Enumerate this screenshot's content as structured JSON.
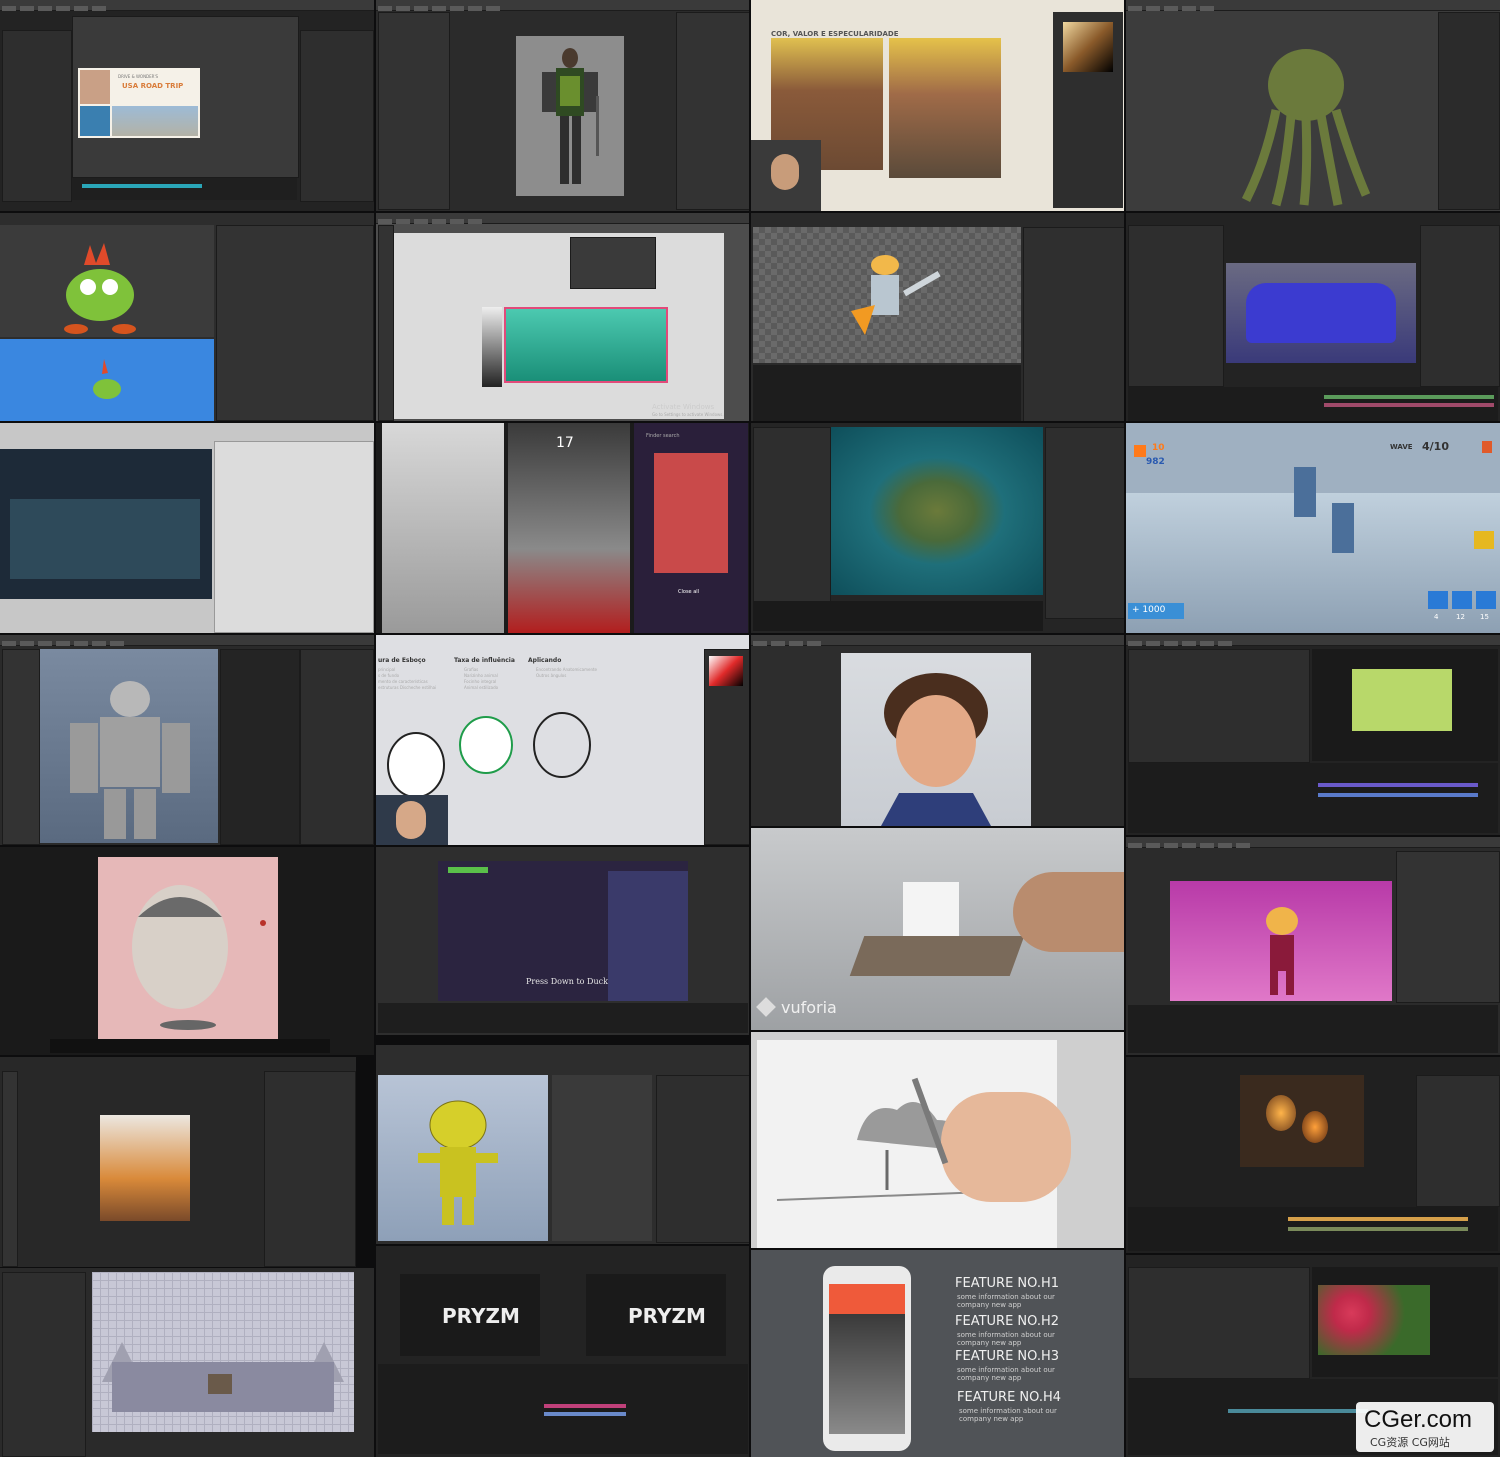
{
  "tiles": {
    "t1": {
      "overlay_title": "USA ROAD TRIP",
      "overlay_header": "DRIVE & WONDER'S"
    },
    "t2": {},
    "t3": {
      "heading": "COR, VALOR E ESPECULARIDADE"
    },
    "t4": {},
    "t5": {},
    "t6": {
      "watermark_line1": "Activate Windows",
      "watermark_line2": "Go to Settings to activate Windows."
    },
    "t7": {},
    "t8": {},
    "t9": {},
    "t10": {
      "clock": "17",
      "search_placeholder": "Finder search",
      "close_all": "Close all"
    },
    "t11": {},
    "t12": {
      "coins": "10",
      "gems": "982",
      "wave": "WAVE",
      "wave_count": "4/10",
      "bonus": "+ 1000",
      "cost1": "4",
      "cost2": "12",
      "cost3": "15"
    },
    "t13": {},
    "t14": {
      "col1": "ura de Esboço",
      "col2": "Taxa de influência",
      "col3": "Aplicando",
      "col1_items": [
        "principal",
        "s de fundo",
        "mento de características",
        "estruturas Discheche estilhai"
      ],
      "col2_items": [
        "Grafias",
        "Narizinho animal",
        "Focinho integral",
        "Animal estilizado"
      ],
      "col3_items": [
        "Encontrando Anatomicamente",
        "Outros ângulos"
      ]
    },
    "t15": {},
    "t16": {},
    "t17": {},
    "t18": {
      "caption": "Press Down to Duck"
    },
    "t19": {
      "brand": "vuforia"
    },
    "t20": {},
    "t21": {},
    "t22": {},
    "t23": {},
    "t24": {},
    "t25": {},
    "t26": {
      "logo_text": "PRYZM"
    },
    "t27": {
      "features": [
        {
          "title": "FEATURE NO.H1",
          "desc": "some information about our company new app"
        },
        {
          "title": "FEATURE NO.H2",
          "desc": "some information about our company new app"
        },
        {
          "title": "FEATURE NO.H3",
          "desc": "some information about our company new app"
        },
        {
          "title": "FEATURE NO.H4",
          "desc": "some information about our company new app"
        }
      ]
    },
    "t28": {}
  },
  "watermark": {
    "name": "CGer.com",
    "sub": "CG资源 CG网站"
  }
}
